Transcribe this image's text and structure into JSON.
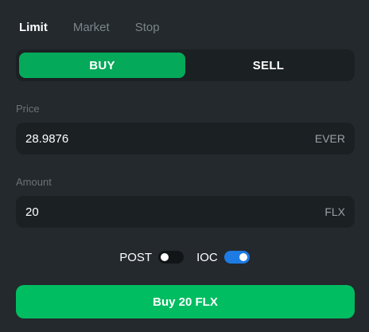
{
  "order_tabs": [
    {
      "label": "Limit",
      "active": true
    },
    {
      "label": "Market",
      "active": false
    },
    {
      "label": "Stop",
      "active": false
    }
  ],
  "side": {
    "buy_label": "BUY",
    "sell_label": "SELL",
    "selected": "BUY"
  },
  "price": {
    "label": "Price",
    "value": "28.9876",
    "unit": "EVER"
  },
  "amount": {
    "label": "Amount",
    "value": "20",
    "unit": "FLX"
  },
  "options": {
    "post": {
      "label": "POST",
      "enabled": false
    },
    "ioc": {
      "label": "IOC",
      "enabled": true
    }
  },
  "submit_label": "Buy 20 FLX",
  "colors": {
    "background": "#23292d",
    "field_bg": "#1b2023",
    "buy_active": "#04a959",
    "submit": "#01bd61",
    "toggle_on": "#1d7be3"
  }
}
